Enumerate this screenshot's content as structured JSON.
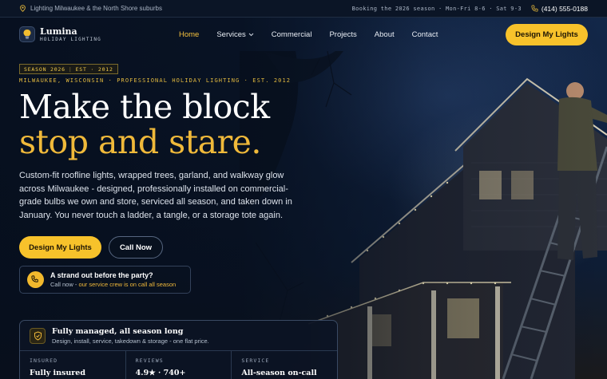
{
  "topbar": {
    "service_area": "Lighting Milwaukee & the North Shore suburbs",
    "hours": "Booking the 2026 season · Mon-Fri 8-6 · Sat 9-3",
    "phone": "(414) 555-0188"
  },
  "brand": {
    "name": "Lumina",
    "tagline": "HOLIDAY LIGHTING"
  },
  "nav": {
    "items": [
      {
        "label": "Home",
        "active": true
      },
      {
        "label": "Services",
        "has_dropdown": true
      },
      {
        "label": "Commercial"
      },
      {
        "label": "Projects"
      },
      {
        "label": "About"
      },
      {
        "label": "Contact"
      }
    ],
    "cta": "Design My Lights"
  },
  "hero": {
    "badge_season": "SEASON 2026",
    "badge_est": "EST · 2012",
    "location_line": "MILWAUKEE, WISCONSIN · PROFESSIONAL HOLIDAY LIGHTING · EST. 2012",
    "headline_line1": "Make the block",
    "headline_line2": "stop and stare.",
    "lede": "Custom-fit roofline lights, wrapped trees, garland, and walkway glow across Milwaukee - designed, professionally installed on commercial-grade bulbs we own and store, serviced all season, and taken down in January. You never touch a ladder, a tangle, or a storage tote again.",
    "primary_button": "Design My Lights",
    "secondary_button": "Call Now",
    "oncall_title": "A strand out before the party?",
    "oncall_prefix": "Call now - ",
    "oncall_highlight": "our service crew is on call all season"
  },
  "card": {
    "title": "Fully managed, all season long",
    "subtitle": "Design, install, service, takedown & storage - one flat price.",
    "stats": [
      {
        "key": "INSURED",
        "value": "Fully insured"
      },
      {
        "key": "REVIEWS",
        "value": "4.9★ · 740+"
      },
      {
        "key": "SERVICE",
        "value": "All-season on-call"
      }
    ]
  },
  "colors": {
    "accent": "#f7c22b",
    "gold_text": "#f0b93a",
    "navy": "#0b1526"
  },
  "icons": [
    "map-pin-icon",
    "phone-icon",
    "lightbulb-icon",
    "chevron-down-icon",
    "wrench-icon",
    "shield-check-icon"
  ]
}
